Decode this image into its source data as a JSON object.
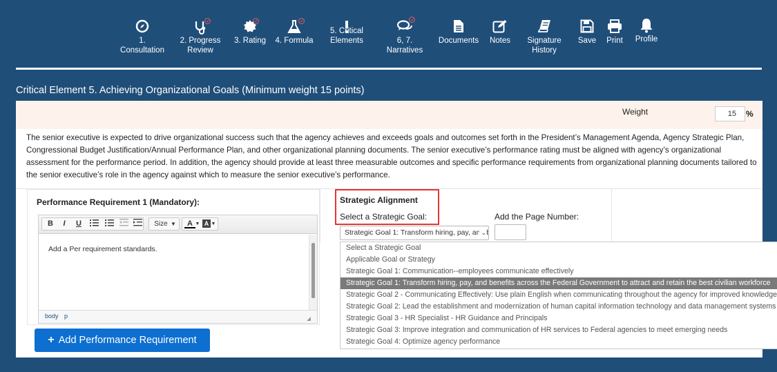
{
  "toolbar": {
    "items": [
      {
        "label": "1.\nConsultation",
        "icon": "compass-icon"
      },
      {
        "label": "2. Progress\nReview",
        "icon": "stethoscope-icon"
      },
      {
        "label": "3. Rating",
        "icon": "badge-icon"
      },
      {
        "label": "4. Formula",
        "icon": "flask-icon"
      },
      {
        "label": "5. Critical\nElements",
        "icon": "exclamation-icon"
      },
      {
        "label": "6, 7.\nNarratives",
        "icon": "comments-icon"
      },
      {
        "label": "Documents",
        "icon": "document-icon"
      },
      {
        "label": "Notes",
        "icon": "edit-icon"
      },
      {
        "label": "Signature\nHistory",
        "icon": "book-icon"
      },
      {
        "label": "Save",
        "icon": "save-icon"
      },
      {
        "label": "Print",
        "icon": "printer-icon"
      },
      {
        "label": "Profile",
        "icon": "bell-icon"
      }
    ]
  },
  "section_title": "Critical Element 5. Achieving Organizational Goals (Minimum weight 15 points)",
  "weight": {
    "label": "Weight",
    "value": "15",
    "unit": "%"
  },
  "description": "The senior executive is expected to drive organizational success such that the agency achieves and exceeds goals and outcomes set forth in the President’s Management Agenda, Agency Strategic Plan, Congressional Budget Justification/Annual Performance Plan, and other organizational planning documents. The senior executive’s performance rating must be aligned with agency’s organizational assessment for the performance period. In addition, the agency should provide at least three measurable outcomes and specific performance requirements from organizational planning documents tailored to the senior executive’s role in the agency against which to measure the senior executive’s performance.",
  "performance_requirement": {
    "label": "Performance Requirement 1 (Mandatory):",
    "editor_toolbar": {
      "bold": "B",
      "italic": "I",
      "underline": "U",
      "size": "Size",
      "text_color": "A",
      "bg_color": "A"
    },
    "placeholder": "Add a Per requirement standards.",
    "status_path": [
      "body",
      "p"
    ]
  },
  "add_button": {
    "label": "Add Performance Requirement"
  },
  "strategic_alignment": {
    "title": "Strategic Alignment",
    "goal_label": "Select a Strategic Goal:",
    "page_label": "Add the Page Number:",
    "selected": "Strategic Goal 1: Transform hiring, pay, and benefits across the Federal Government to attract and retain the best civilian workforce",
    "page_value": "",
    "options": [
      "Select a Strategic Goal",
      "Applicable Goal or Strategy",
      "Strategic Goal 1: Communication--employees communicate effectively",
      "Strategic Goal 1: Transform hiring, pay, and benefits across the Federal Government to attract and retain the best civilian workforce",
      "Strategic Goal 2 - Communicating Effectively: Use plain English when communicating throughout the agency for improved knowledge",
      "Strategic Goal 2: Lead the establishment and modernization of human capital information technology and data management systems",
      "Strategic Goal 3 - HR Specialist - HR Guidance and Principals",
      "Strategic Goal 3: Improve integration and communication of HR services to Federal agencies to meet emerging needs",
      "Strategic Goal 4: Optimize agency performance"
    ],
    "selected_index": 3
  },
  "colors": {
    "background": "#1f4e79",
    "accent_button": "#0d6fd0",
    "highlight_border": "#e33535",
    "weight_row": "#fdf3ec"
  }
}
